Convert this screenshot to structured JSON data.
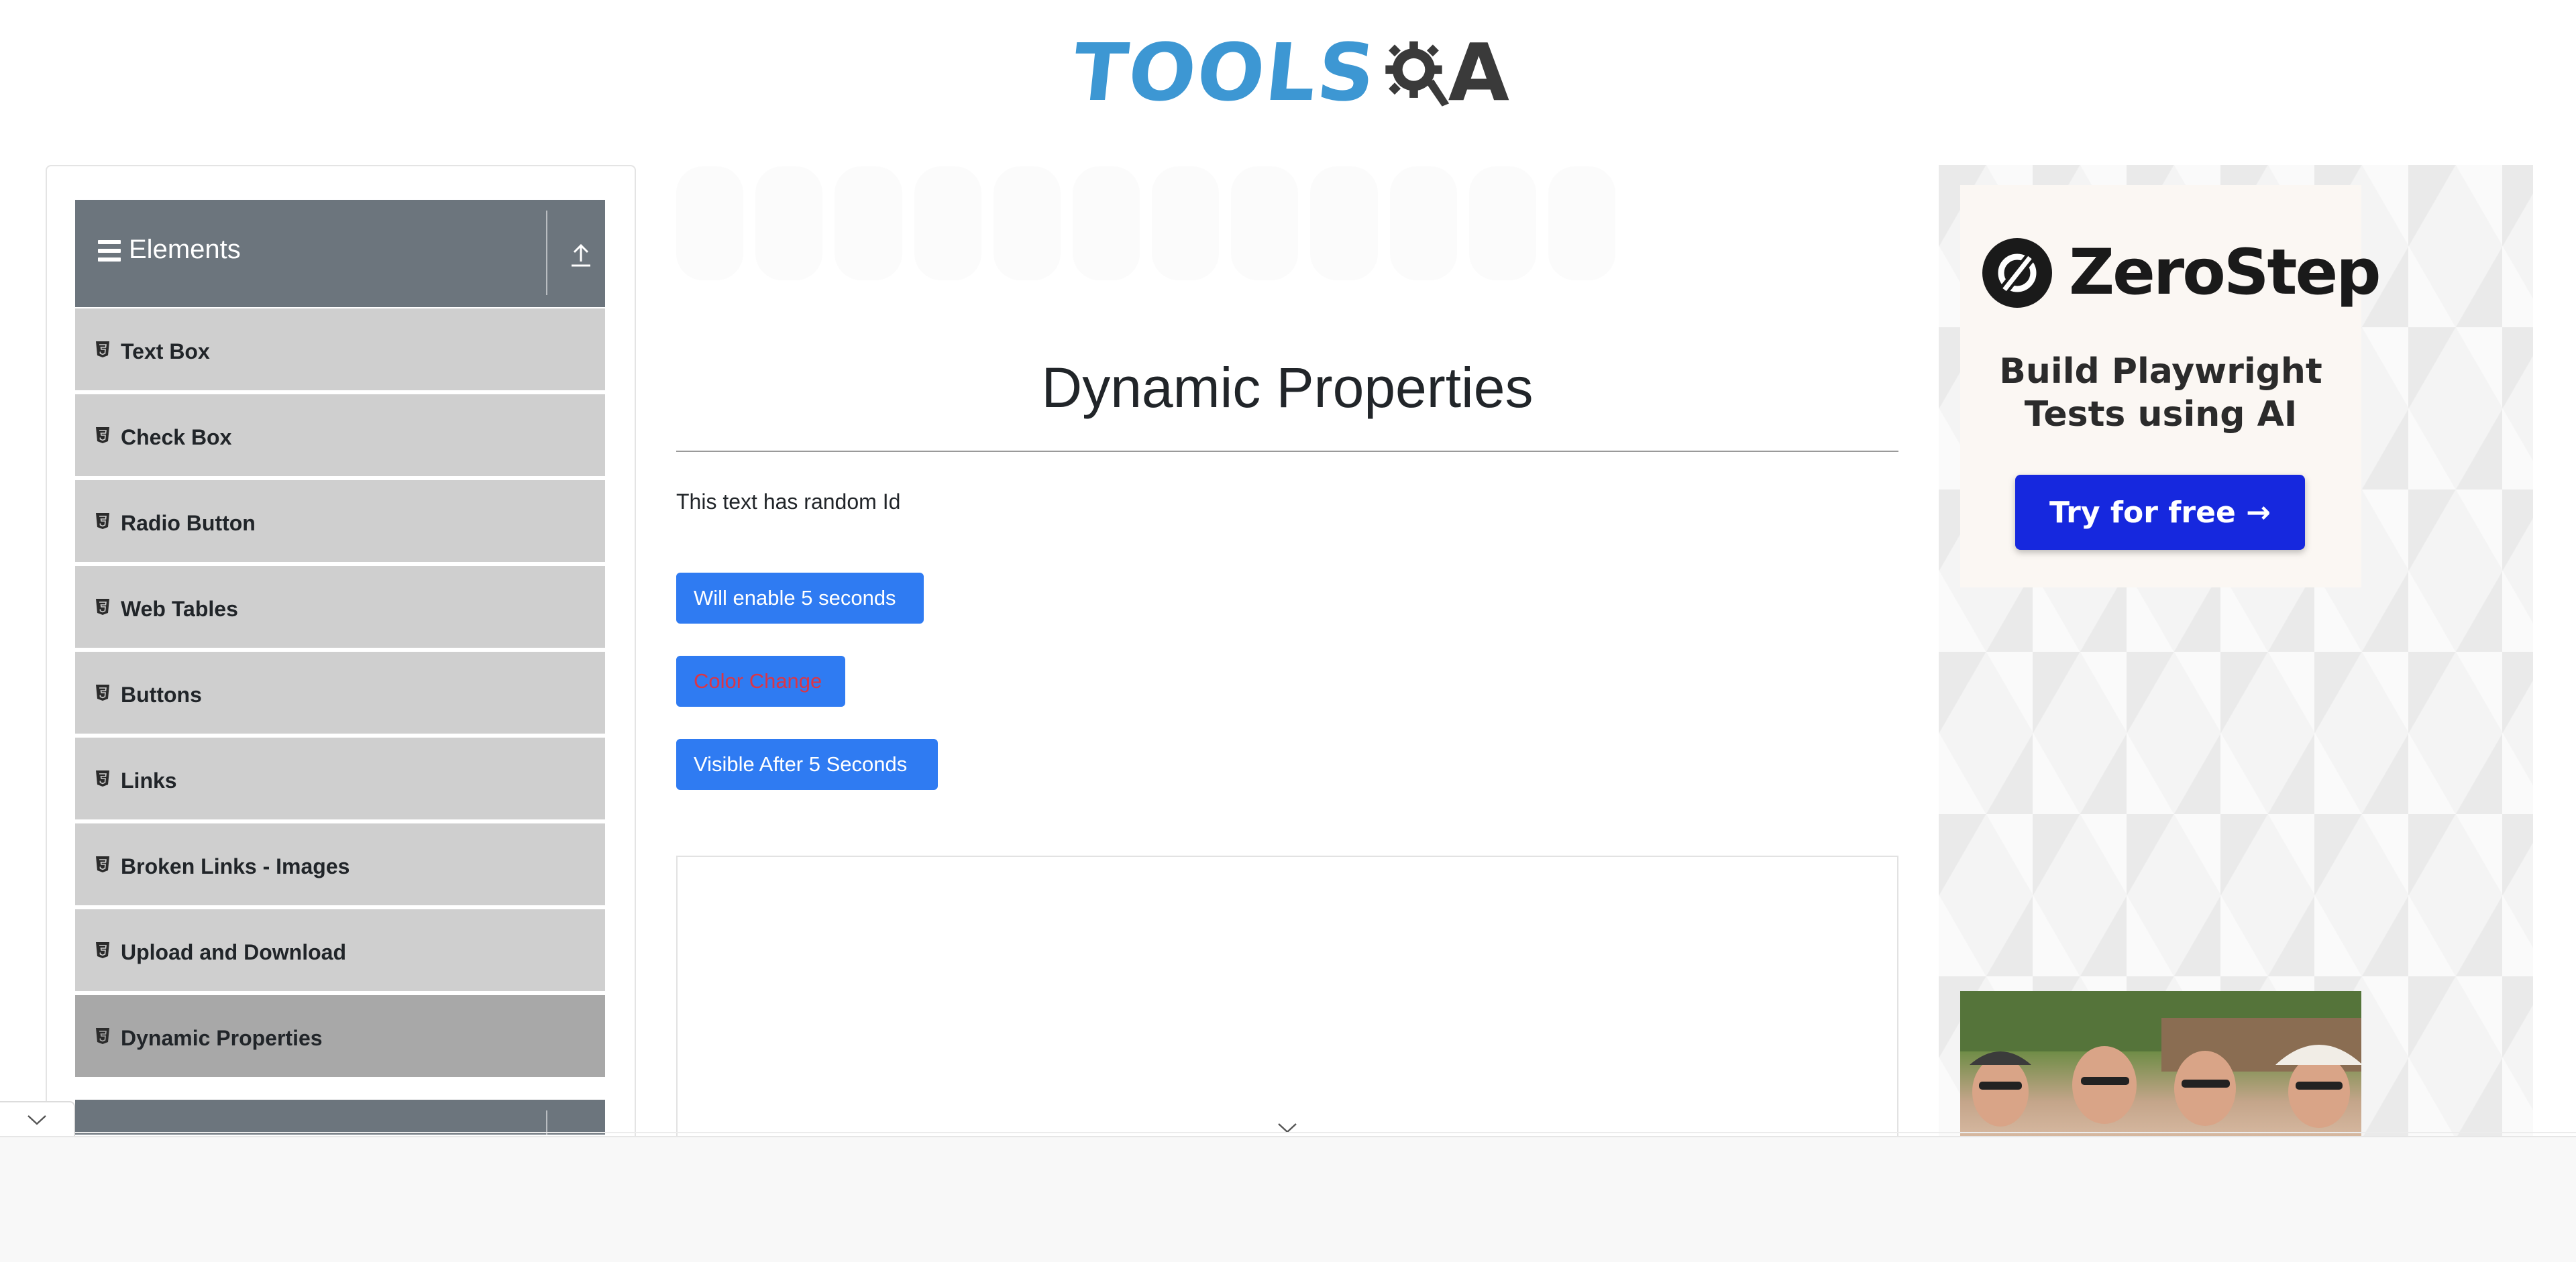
{
  "header": {
    "logo_part1": "TOOLS",
    "logo_part2": "A",
    "logo_colors": {
      "tools": "#3d97d3",
      "gear": "#3a3a3a"
    }
  },
  "sidebar": {
    "group_title": "Elements",
    "items": [
      {
        "label": "Text Box"
      },
      {
        "label": "Check Box"
      },
      {
        "label": "Radio Button"
      },
      {
        "label": "Web Tables"
      },
      {
        "label": "Buttons"
      },
      {
        "label": "Links"
      },
      {
        "label": "Broken Links - Images"
      },
      {
        "label": "Upload and Download"
      },
      {
        "label": "Dynamic Properties",
        "active": true
      }
    ]
  },
  "main": {
    "title": "Dynamic Properties",
    "random_text": "This text has random Id",
    "buttons": {
      "enable": "Will enable 5 seconds",
      "color": "Color Change",
      "visible": "Visible After 5 Seconds"
    }
  },
  "ads": {
    "zerostep": {
      "brand": "ZeroStep",
      "tagline_line1": "Build Playwright",
      "tagline_line2": "Tests using AI",
      "cta": "Try for free →",
      "cta_color": "#1628de"
    }
  },
  "colors": {
    "primary_button": "#2f7bf2",
    "danger_text": "#dc3545",
    "sidebar_header": "#6c757d",
    "menu_item": "#cfcfcf",
    "menu_item_active": "#a8a8a8"
  }
}
